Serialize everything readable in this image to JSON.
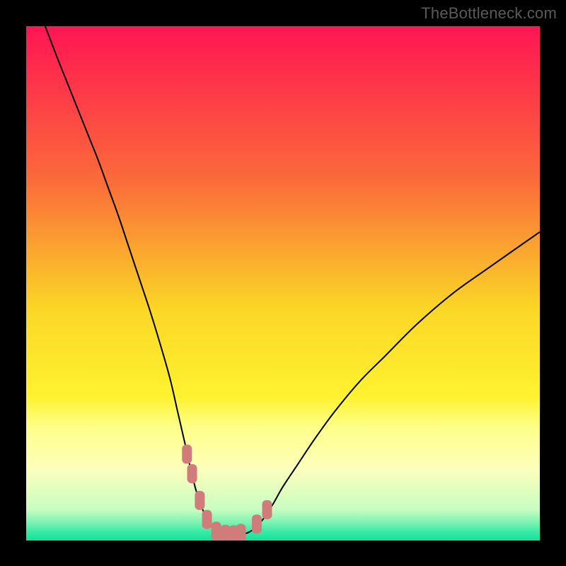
{
  "watermark": "TheBottleneck.com",
  "chart_data": {
    "type": "line",
    "title": "",
    "xlabel": "",
    "ylabel": "",
    "xlim": [
      0,
      100
    ],
    "ylim": [
      0,
      100
    ],
    "grid": false,
    "series": [
      {
        "name": "bottleneck-curve",
        "color": "#000000",
        "x": [
          3.7,
          6,
          8,
          10,
          12,
          14,
          16,
          18,
          20,
          22,
          24,
          26,
          28,
          29.5,
          31,
          32,
          33,
          34,
          35,
          36,
          37,
          38,
          39,
          40,
          41,
          42.5,
          44,
          46,
          48,
          50,
          53,
          56,
          60,
          65,
          70,
          76,
          83,
          90,
          100
        ],
        "y": [
          100,
          94,
          89,
          84,
          79,
          74,
          68.5,
          63,
          57,
          51,
          45,
          38.5,
          31.5,
          25,
          18.5,
          14,
          10,
          7,
          4.5,
          2.8,
          1.8,
          1.2,
          1.0,
          1.0,
          1.0,
          1.3,
          2,
          4,
          7,
          10.5,
          15,
          19.5,
          25,
          31,
          36,
          42,
          48,
          53,
          60
        ]
      },
      {
        "name": "highlight-markers",
        "color": "#d07c7a",
        "x": [
          31.3,
          32.3,
          33.8,
          35.2,
          37.0,
          38.8,
          40.4,
          41.8,
          44.9,
          46.9
        ],
        "y": [
          16.8,
          13.0,
          7.8,
          4.1,
          1.8,
          1.2,
          1.1,
          1.4,
          3.2,
          6.0
        ]
      }
    ],
    "background_gradient": {
      "stops": [
        {
          "pos": 0.0,
          "color": "#ff1553"
        },
        {
          "pos": 0.3,
          "color": "#fb6b3a"
        },
        {
          "pos": 0.55,
          "color": "#fbd726"
        },
        {
          "pos": 0.72,
          "color": "#fef230"
        },
        {
          "pos": 0.78,
          "color": "#feff89"
        },
        {
          "pos": 0.86,
          "color": "#fdffbc"
        },
        {
          "pos": 0.94,
          "color": "#c8fdc2"
        },
        {
          "pos": 0.965,
          "color": "#7bf3b2"
        },
        {
          "pos": 0.985,
          "color": "#33e9a5"
        },
        {
          "pos": 1.0,
          "color": "#10e39d"
        }
      ]
    }
  }
}
